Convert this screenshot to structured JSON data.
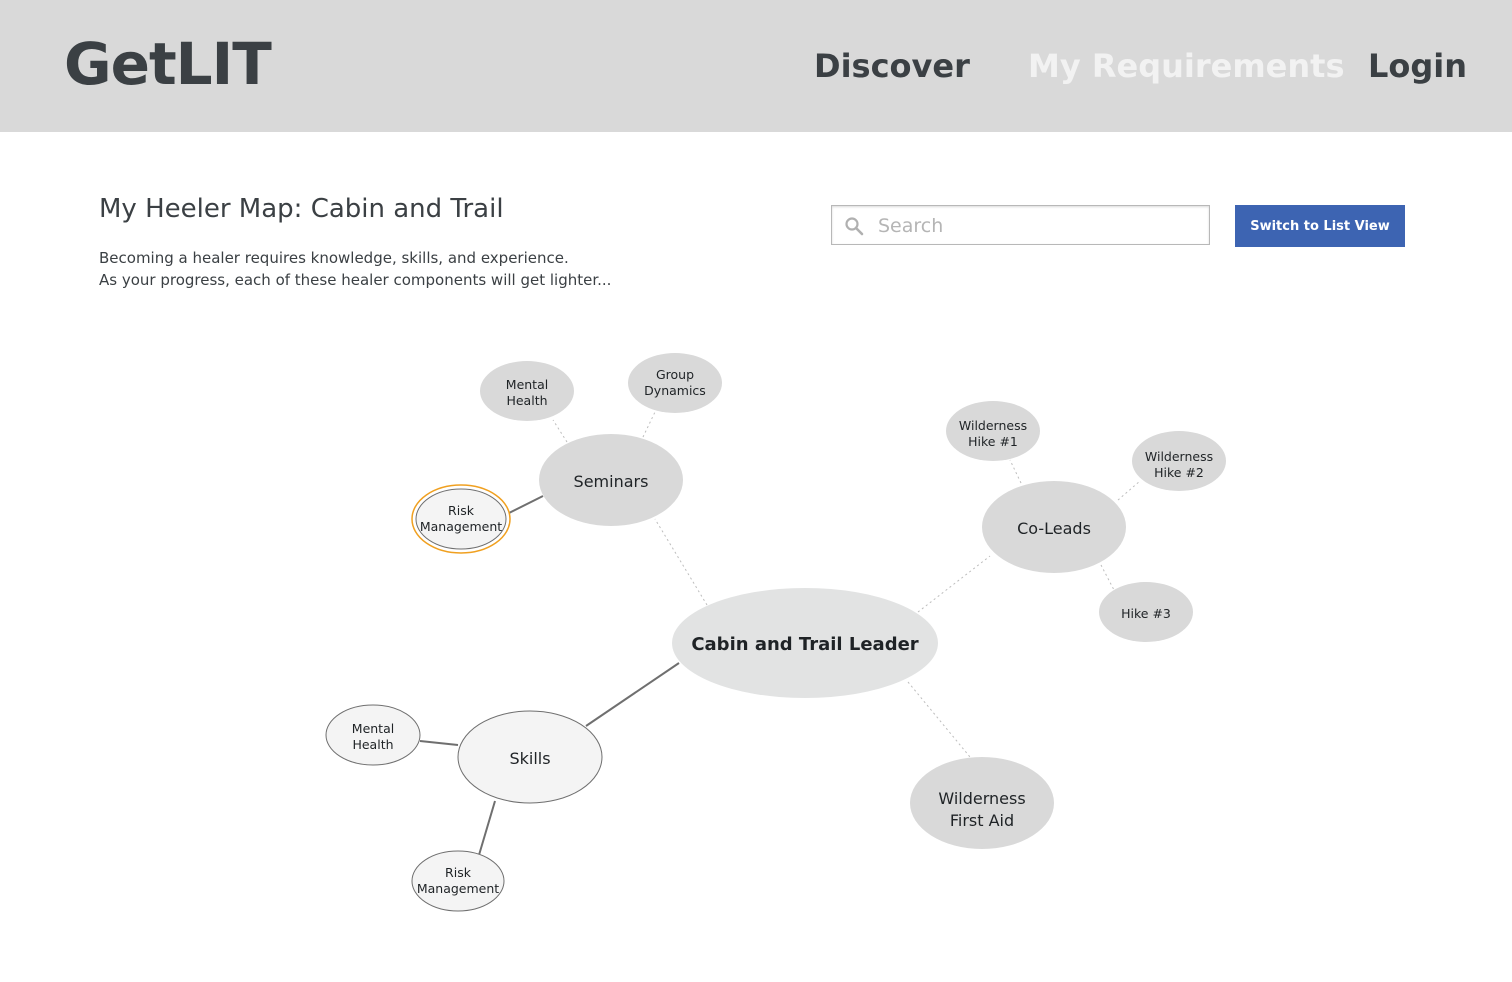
{
  "header": {
    "logo": "GetLIT",
    "nav": {
      "discover": "Discover",
      "my_requirements": "My Requirements",
      "login": "Login"
    }
  },
  "main": {
    "title": "My Heeler Map: Cabin and Trail",
    "description_line1": "Becoming a healer requires knowledge, skills, and experience.",
    "description_line2": "As your progress, each of these healer components will get lighter...",
    "search": {
      "placeholder": "Search",
      "value": ""
    },
    "switch_button": "Switch to List View"
  },
  "map": {
    "center": {
      "label": "Cabin and Trail Leader"
    },
    "seminars": {
      "label": "Seminars",
      "mental_health": [
        "Mental",
        "Health"
      ],
      "group_dynamics": [
        "Group",
        "Dynamics"
      ],
      "risk_management": [
        "Risk",
        "Management"
      ]
    },
    "coleads": {
      "label": "Co-Leads",
      "hike1": [
        "Wilderness",
        "Hike #1"
      ],
      "hike2": [
        "Wilderness",
        "Hike #2"
      ],
      "hike3": "Hike #3"
    },
    "skills": {
      "label": "Skills",
      "mental_health": [
        "Mental",
        "Health"
      ],
      "risk_management": [
        "Risk",
        "Management"
      ]
    },
    "first_aid": {
      "label": [
        "Wilderness",
        "First Aid"
      ]
    }
  },
  "colors": {
    "accent_button": "#3d64b2",
    "header_bg": "#d9d9d9",
    "node_incomplete": "#d9d9d9",
    "node_complete": "#f4f4f4",
    "highlight_ring": "#f0a020"
  }
}
